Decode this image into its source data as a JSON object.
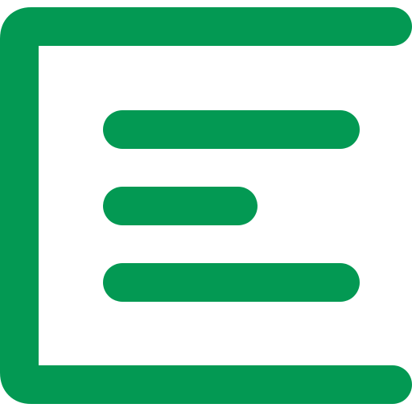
{
  "icon": {
    "name": "align-left-text-icon",
    "color": "#039953"
  }
}
